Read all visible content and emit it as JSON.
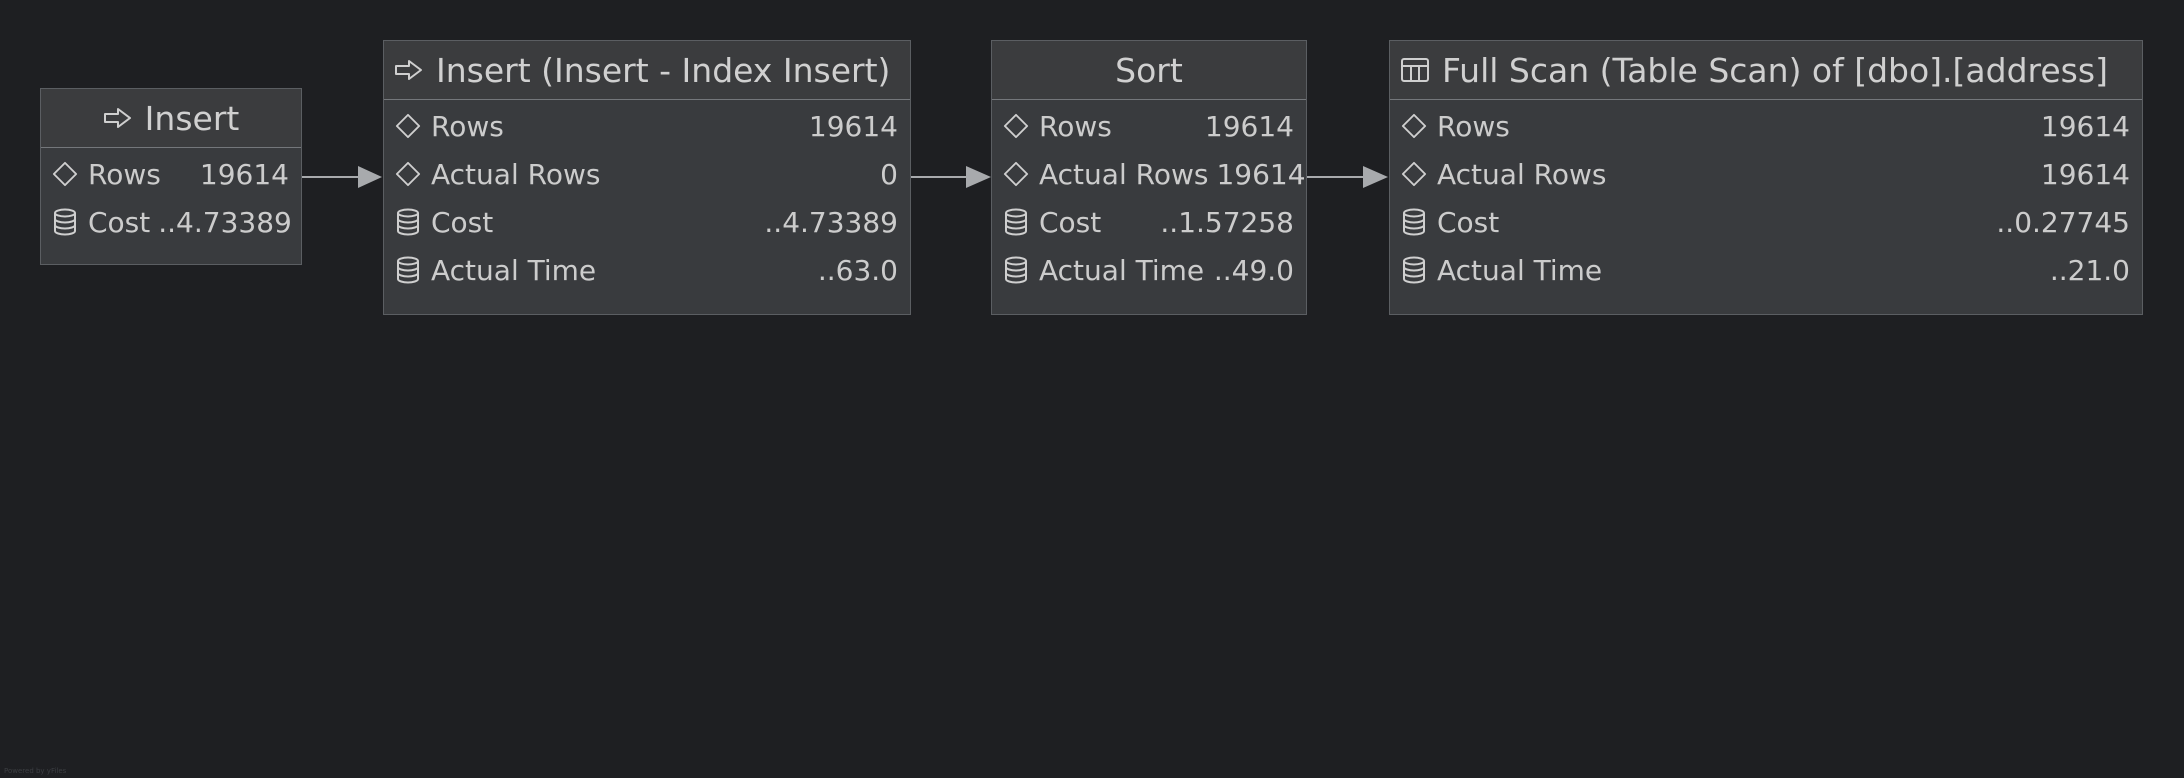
{
  "colors": {
    "background": "#1e1f22",
    "node_fill": "#393b3e",
    "node_border": "#5b5e62",
    "text": "#cccccc",
    "edge": "#a8aaad"
  },
  "nodes": [
    {
      "title": "Insert",
      "icon": "arrow-right-icon",
      "rows": [
        {
          "icon": "diamond-icon",
          "label": "Rows",
          "value": "19614"
        },
        {
          "icon": "database-icon",
          "label": "Cost",
          "value": "..4.73389"
        }
      ]
    },
    {
      "title": "Insert (Insert - Index Insert)",
      "icon": "arrow-right-icon",
      "rows": [
        {
          "icon": "diamond-icon",
          "label": "Rows",
          "value": "19614"
        },
        {
          "icon": "diamond-icon",
          "label": "Actual Rows",
          "value": "0"
        },
        {
          "icon": "database-icon",
          "label": "Cost",
          "value": "..4.73389"
        },
        {
          "icon": "database-icon",
          "label": "Actual Time",
          "value": "..63.0"
        }
      ]
    },
    {
      "title": "Sort",
      "icon": "",
      "rows": [
        {
          "icon": "diamond-icon",
          "label": "Rows",
          "value": "19614"
        },
        {
          "icon": "diamond-icon",
          "label": "Actual Rows",
          "value": "19614"
        },
        {
          "icon": "database-icon",
          "label": "Cost",
          "value": "..1.57258"
        },
        {
          "icon": "database-icon",
          "label": "Actual Time",
          "value": "..49.0"
        }
      ]
    },
    {
      "title": "Full Scan (Table Scan) of [dbo].[address]",
      "icon": "table-icon",
      "rows": [
        {
          "icon": "diamond-icon",
          "label": "Rows",
          "value": "19614"
        },
        {
          "icon": "diamond-icon",
          "label": "Actual Rows",
          "value": "19614"
        },
        {
          "icon": "database-icon",
          "label": "Cost",
          "value": "..0.27745"
        },
        {
          "icon": "database-icon",
          "label": "Actual Time",
          "value": "..21.0"
        }
      ]
    }
  ],
  "edges": [
    {
      "from": 0,
      "to": 1
    },
    {
      "from": 1,
      "to": 2
    },
    {
      "from": 2,
      "to": 3
    }
  ],
  "footer": {
    "credit": "Powered by yFiles"
  }
}
